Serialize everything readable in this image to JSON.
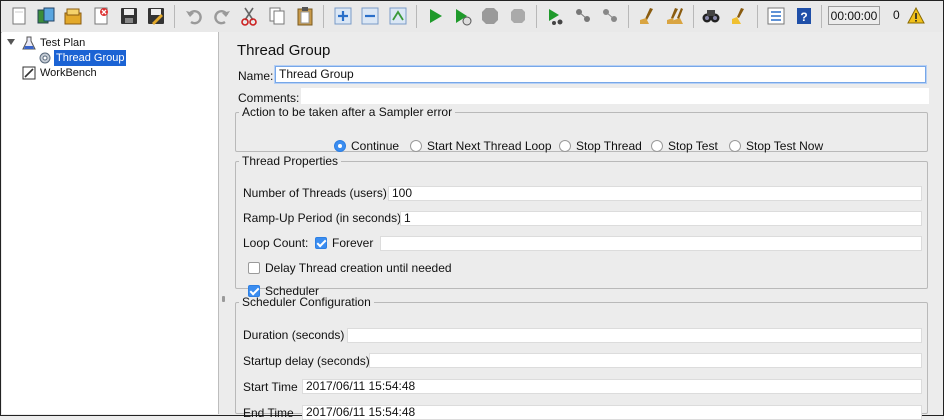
{
  "toolbar": {
    "timer": "00:00:00",
    "error_count": "0",
    "buttons": [
      {
        "name": "new-icon"
      },
      {
        "name": "templates-icon"
      },
      {
        "name": "open-icon"
      },
      {
        "name": "close-icon"
      },
      {
        "name": "save-icon"
      },
      {
        "name": "save-as-icon"
      },
      {
        "name": "undo-icon"
      },
      {
        "name": "redo-icon"
      },
      {
        "name": "cut-icon"
      },
      {
        "name": "copy-icon"
      },
      {
        "name": "paste-icon"
      },
      {
        "name": "expand-icon"
      },
      {
        "name": "collapse-icon"
      },
      {
        "name": "toggle-icon"
      },
      {
        "name": "start-icon"
      },
      {
        "name": "start-no-timers-icon"
      },
      {
        "name": "stop-icon"
      },
      {
        "name": "shutdown-icon"
      },
      {
        "name": "remote-start-icon"
      },
      {
        "name": "remote-stop-icon"
      },
      {
        "name": "remote-shutdown-icon"
      },
      {
        "name": "clear-icon"
      },
      {
        "name": "clear-all-icon"
      },
      {
        "name": "search-icon"
      },
      {
        "name": "reset-search-icon"
      },
      {
        "name": "function-helper-icon"
      },
      {
        "name": "help-icon"
      }
    ]
  },
  "tree": {
    "items": [
      {
        "label": "Test Plan"
      },
      {
        "label": "Thread Group"
      },
      {
        "label": "WorkBench"
      }
    ]
  },
  "panel": {
    "title": "Thread Group",
    "name_label": "Name:",
    "name_value": "Thread Group",
    "comments_label": "Comments:",
    "sampler_error": {
      "legend": "Action to be taken after a Sampler error",
      "options": [
        "Continue",
        "Start Next Thread Loop",
        "Stop Thread",
        "Stop Test",
        "Stop Test Now"
      ],
      "selected": "Continue"
    },
    "thread_properties": {
      "legend": "Thread Properties",
      "threads_label": "Number of Threads (users):",
      "threads_value": "100",
      "rampup_label": "Ramp-Up Period (in seconds):",
      "rampup_value": "1",
      "loop_label": "Loop Count:",
      "forever_label": "Forever",
      "forever_checked": true,
      "delay_label": "Delay Thread creation until needed",
      "delay_checked": false,
      "scheduler_label": "Scheduler",
      "scheduler_checked": true
    },
    "scheduler": {
      "legend": "Scheduler Configuration",
      "duration_label": "Duration (seconds)",
      "startup_label": "Startup delay (seconds)",
      "start_label": "Start Time",
      "start_value": "2017/06/11 15:54:48",
      "end_label": "End Time",
      "end_value": "2017/06/11 15:54:48"
    }
  }
}
